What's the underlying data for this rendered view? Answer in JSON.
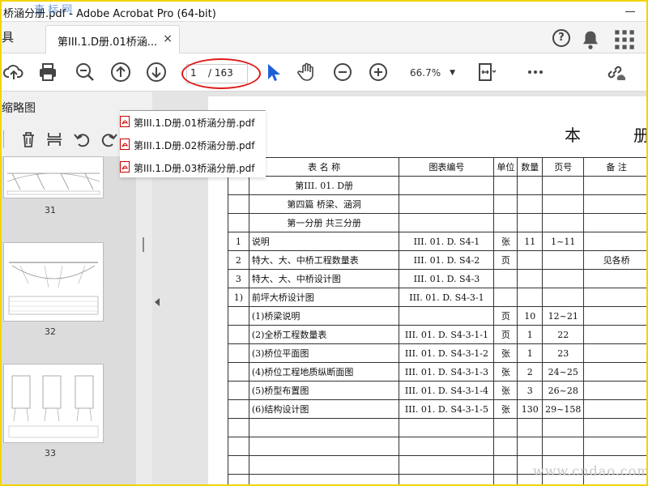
{
  "window": {
    "title": "桥涵分册.pdf - Adobe Acrobat Pro (64-bit)"
  },
  "watermark_top": "查 标 网",
  "watermark_bottom": "www.cndao.com",
  "tabs": {
    "home_label": "具",
    "doc_label": "第III.1.D册.01桥涵...",
    "close": "×"
  },
  "topbar": {
    "help": "?"
  },
  "pager": {
    "current": "1",
    "total": "/ 163"
  },
  "zoom": {
    "value": "66.7%",
    "caret": "▼"
  },
  "left_panel": {
    "header": "缩略图",
    "thumbs": [
      {
        "num": "31"
      },
      {
        "num": "32"
      },
      {
        "num": "33"
      }
    ]
  },
  "file_menu": [
    {
      "name": "第III.1.D册.01桥涵分册.pdf"
    },
    {
      "name": "第III.1.D册.02桥涵分册.pdf"
    },
    {
      "name": "第III.1.D册.03桥涵分册.pdf"
    }
  ],
  "page": {
    "title_left": "本",
    "title_right": "册",
    "table": {
      "headers": [
        "表 名 称",
        "图表编号",
        "单位",
        "数量",
        "页号",
        "备 注"
      ],
      "rows": [
        {
          "no": "",
          "name": "第III. 01. D册",
          "code": "",
          "unit": "",
          "qty": "",
          "page": "",
          "note": "",
          "center": true
        },
        {
          "no": "",
          "name": "第四篇 桥梁、涵洞",
          "code": "",
          "unit": "",
          "qty": "",
          "page": "",
          "note": "",
          "center": true
        },
        {
          "no": "",
          "name": "第一分册 共三分册",
          "code": "",
          "unit": "",
          "qty": "",
          "page": "",
          "note": "",
          "center": true
        },
        {
          "no": "1",
          "name": "说明",
          "code": "III. 01. D. S4-1",
          "unit": "张",
          "qty": "11",
          "page": "1~11",
          "note": ""
        },
        {
          "no": "2",
          "name": "特大、大、中桥工程数量表",
          "code": "III. 01. D. S4-2",
          "unit": "页",
          "qty": "",
          "page": "",
          "note": "见各桥"
        },
        {
          "no": "3",
          "name": "特大、大、中桥设计图",
          "code": "III. 01. D. S4-3",
          "unit": "",
          "qty": "",
          "page": "",
          "note": ""
        },
        {
          "no": "1)",
          "name": "前坪大桥设计图",
          "code": "III. 01. D. S4-3-1",
          "unit": "",
          "qty": "",
          "page": "",
          "note": ""
        },
        {
          "no": "",
          "name": "(1)桥梁说明",
          "code": "",
          "unit": "页",
          "qty": "10",
          "page": "12~21",
          "note": ""
        },
        {
          "no": "",
          "name": "(2)全桥工程数量表",
          "code": "III. 01. D. S4-3-1-1",
          "unit": "页",
          "qty": "1",
          "page": "22",
          "note": ""
        },
        {
          "no": "",
          "name": "(3)桥位平面图",
          "code": "III. 01. D. S4-3-1-2",
          "unit": "张",
          "qty": "1",
          "page": "23",
          "note": ""
        },
        {
          "no": "",
          "name": "(4)桥位工程地质纵断面图",
          "code": "III. 01. D. S4-3-1-3",
          "unit": "张",
          "qty": "2",
          "page": "24~25",
          "note": ""
        },
        {
          "no": "",
          "name": "(5)桥型布置图",
          "code": "III. 01. D. S4-3-1-4",
          "unit": "张",
          "qty": "3",
          "page": "26~28",
          "note": ""
        },
        {
          "no": "",
          "name": "(6)结构设计图",
          "code": "III. 01. D. S4-3-1-5",
          "unit": "张",
          "qty": "130",
          "page": "29~158",
          "note": ""
        },
        {
          "no": "",
          "name": "",
          "code": "",
          "unit": "",
          "qty": "",
          "page": "",
          "note": ""
        },
        {
          "no": "",
          "name": "",
          "code": "",
          "unit": "",
          "qty": "",
          "page": "",
          "note": ""
        },
        {
          "no": "",
          "name": "",
          "code": "",
          "unit": "",
          "qty": "",
          "page": "",
          "note": ""
        },
        {
          "no": "",
          "name": "",
          "code": "",
          "unit": "",
          "qty": "",
          "page": "",
          "note": ""
        }
      ]
    }
  },
  "colors": {
    "highlight_oval": "#e01a1a",
    "frame": "#f2d400",
    "cursor_blue": "#1f5fd6"
  }
}
